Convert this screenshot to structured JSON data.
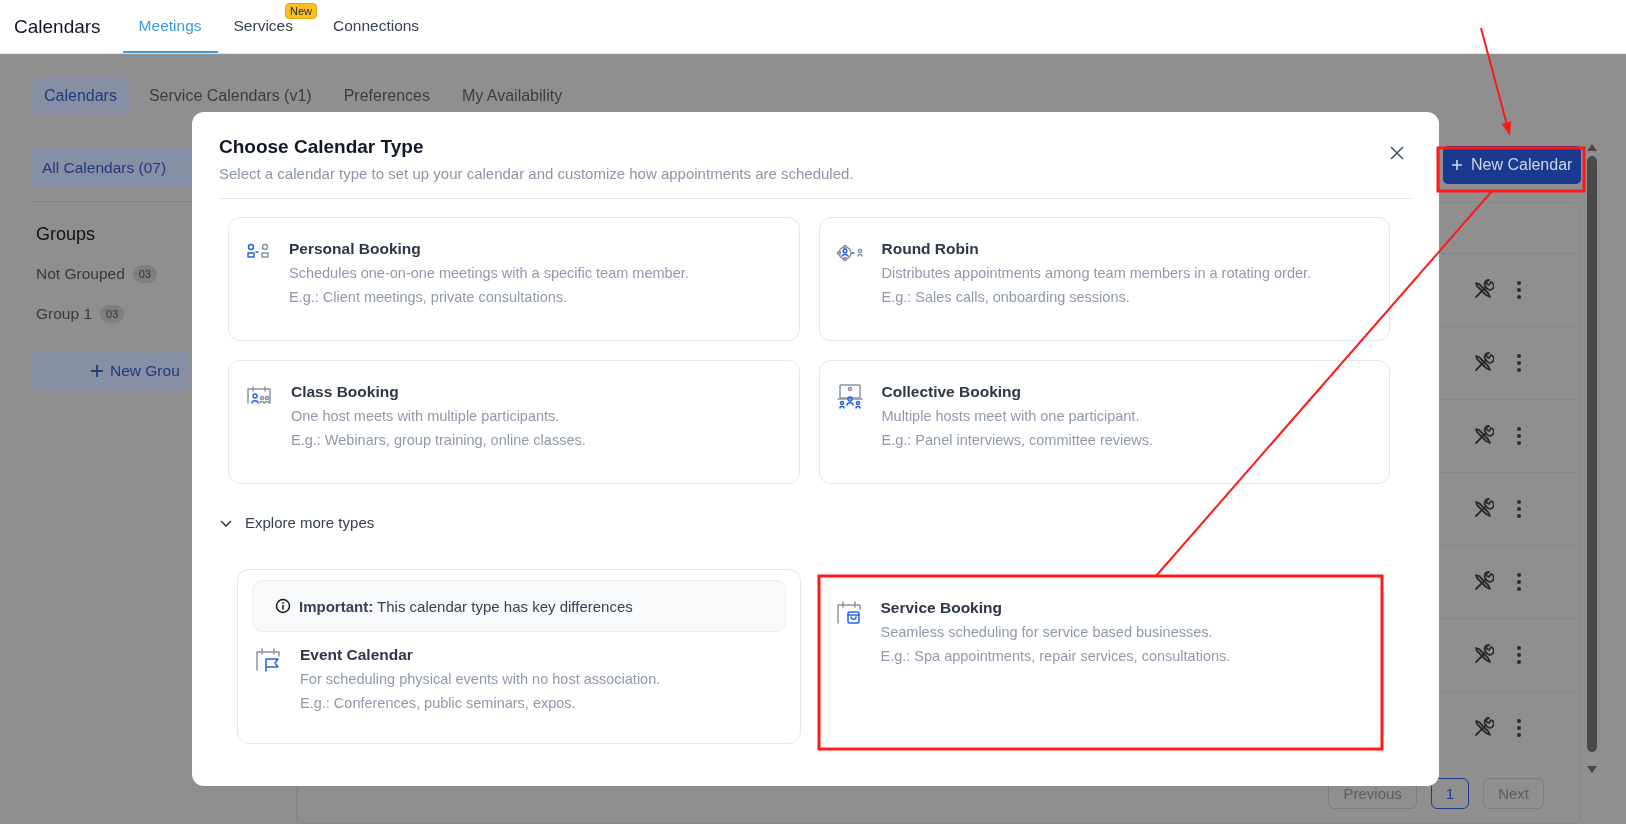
{
  "top_bar": {
    "title": "Calendars",
    "tabs": [
      {
        "label": "Meetings",
        "selected": true
      },
      {
        "label": "Services",
        "selected": false,
        "badge": "New"
      },
      {
        "label": "Connections",
        "selected": false
      }
    ]
  },
  "sub_tabs": [
    {
      "label": "Calendars",
      "selected": true
    },
    {
      "label": "Service Calendars (v1)",
      "selected": false
    },
    {
      "label": "Preferences",
      "selected": false
    },
    {
      "label": "My Availability",
      "selected": false
    }
  ],
  "sidebar": {
    "all_calendars": {
      "label": "All Calendars (07)",
      "selected": true
    },
    "groups_heading": "Groups",
    "groups": [
      {
        "name": "Not Grouped",
        "count": "03"
      },
      {
        "name": "Group 1",
        "count": "03"
      }
    ],
    "new_group_button": "New Grou"
  },
  "new_calendar_button": "New Calendar",
  "table": {
    "rows": [
      {
        "kind": "actions"
      },
      {
        "kind": "actions"
      },
      {
        "kind": "actions"
      },
      {
        "kind": "actions"
      },
      {
        "kind": "actions"
      },
      {
        "kind": "actions"
      },
      {
        "kind": "actions"
      }
    ]
  },
  "pagination": {
    "previous": "Previous",
    "pages": [
      {
        "label": "1",
        "selected": true
      }
    ],
    "next": "Next"
  },
  "modal": {
    "title": "Choose Calendar Type",
    "subtitle": "Select a calendar type to set up your calendar and customize how appointments are scheduled.",
    "types": [
      {
        "title": "Personal Booking",
        "description": "Schedules one-on-one meetings with a specific team member.",
        "example": "E.g.: Client meetings, private consultations."
      },
      {
        "title": "Round Robin",
        "description": "Distributes appointments among team members in a rotating order.",
        "example": "E.g.: Sales calls, onboarding sessions."
      },
      {
        "title": "Class Booking",
        "description": "One host meets with multiple participants.",
        "example": "E.g.: Webinars, group training, online classes."
      },
      {
        "title": "Collective Booking",
        "description": "Multiple hosts meet with one participant.",
        "example": "E.g.: Panel interviews, committee reviews."
      }
    ],
    "explore_toggle": {
      "label": "Explore more types",
      "expanded": true
    },
    "more_types": [
      {
        "notice": "**Important:** This calendar type has key differences",
        "title": "Event Calendar",
        "description": "For scheduling physical events with no host association.",
        "example": "E.g.: Conferences, public seminars, expos."
      },
      {
        "title": "Service Booking",
        "description": "Seamless scheduling for service based businesses.",
        "example": "E.g.: Spa appointments, repair services, consultations."
      }
    ]
  },
  "annotations": [
    {
      "kind": "arrow"
    },
    {
      "kind": "frame"
    },
    {
      "kind": "line"
    },
    {
      "kind": "frame"
    }
  ]
}
